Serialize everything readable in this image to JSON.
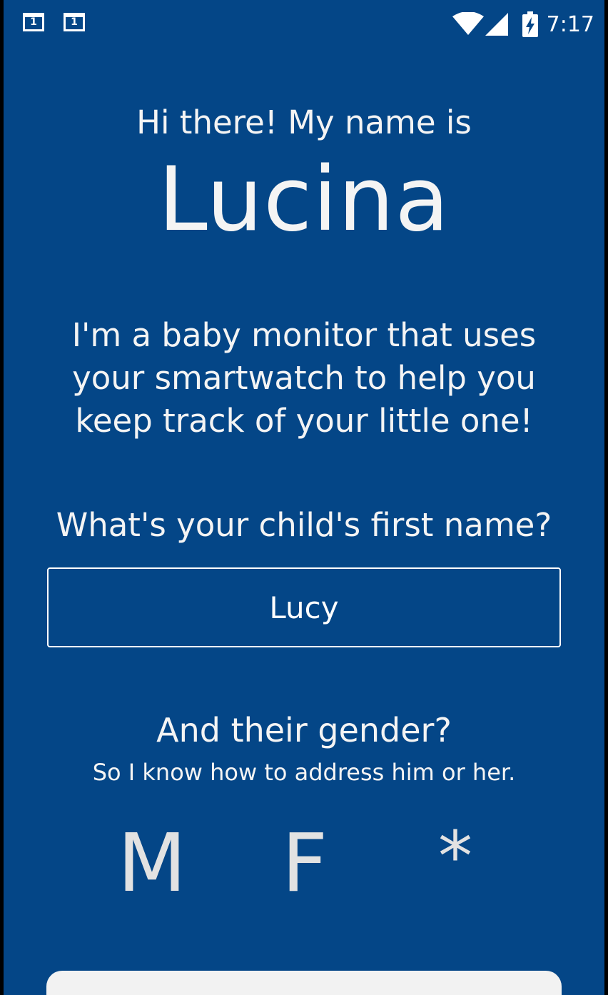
{
  "status_bar": {
    "notification_icons": [
      "1",
      "1"
    ],
    "time": "7:17",
    "icons": [
      "wifi-icon",
      "cell-signal-icon",
      "battery-charging-icon"
    ]
  },
  "welcome": {
    "greeting": "Hi there! My name is",
    "app_name": "Lucina",
    "intro": "I'm a baby monitor that uses your smartwatch to help you keep track of your little one!"
  },
  "child_name": {
    "question": "What's your child's first name?",
    "value": "Lucy",
    "placeholder": ""
  },
  "gender": {
    "question": "And their gender?",
    "subtext": "So I know how to address him or her.",
    "options": [
      "M",
      "F",
      "*"
    ]
  },
  "colors": {
    "background": "#044687",
    "text": "#f4f4f4",
    "card": "#f2f2f2"
  }
}
